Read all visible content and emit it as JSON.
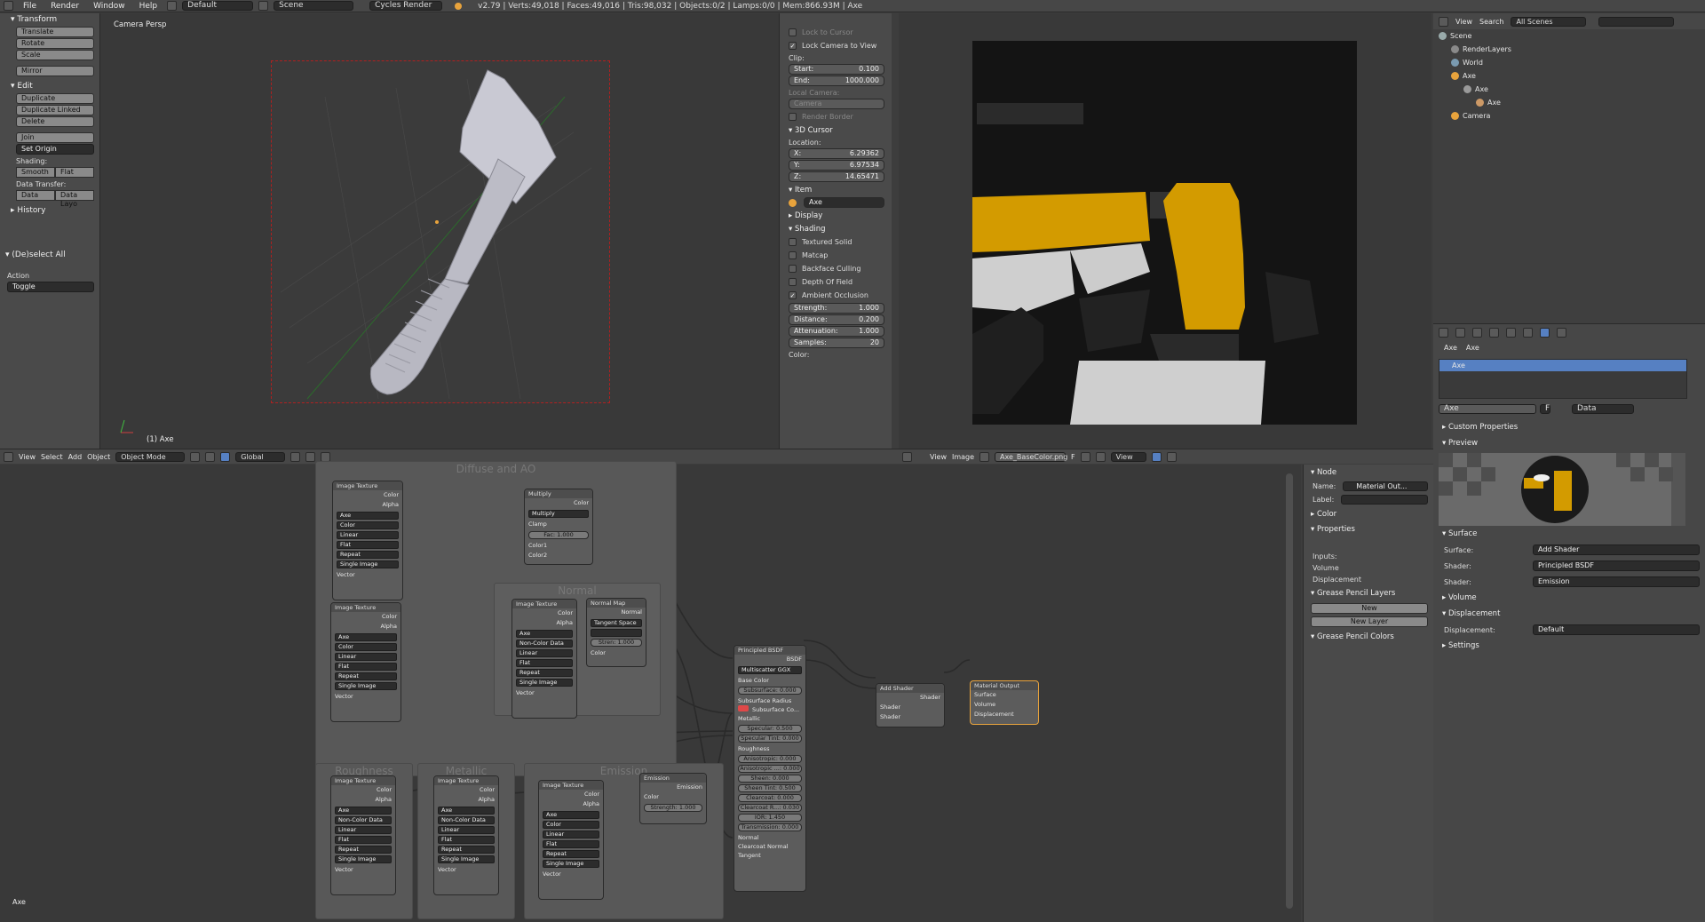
{
  "topbar": {
    "menus": [
      "File",
      "Render",
      "Window",
      "Help"
    ],
    "layout": "Default",
    "scene": "Scene",
    "engine": "Cycles Render",
    "stats": "v2.79 | Verts:49,018 | Faces:49,016 | Tris:98,032 | Objects:0/2 | Lamps:0/0 | Mem:866.93M | Axe"
  },
  "toolshelf": {
    "transform_title": "Transform",
    "translate": "Translate",
    "rotate": "Rotate",
    "scale": "Scale",
    "mirror": "Mirror",
    "edit_title": "Edit",
    "duplicate": "Duplicate",
    "duplicate_linked": "Duplicate Linked",
    "delete": "Delete",
    "join": "Join",
    "set_origin": "Set Origin",
    "shading_label": "Shading:",
    "smooth": "Smooth",
    "flat": "Flat",
    "data_transfer_label": "Data Transfer:",
    "data": "Data",
    "data_layo": "Data Layo",
    "history": "History",
    "deselect_all": "(De)select All",
    "action_label": "Action",
    "action_value": "Toggle"
  },
  "viewport": {
    "label": "Camera Persp",
    "object_label": "(1) Axe"
  },
  "npanel": {
    "lock_to_cursor": "Lock to Cursor",
    "lock_camera": "Lock Camera to View",
    "clip_label": "Clip:",
    "start_label": "Start:",
    "start_value": "0.100",
    "end_label": "End:",
    "end_value": "1000.000",
    "local_camera": "Local Camera:",
    "camera": "Camera",
    "render_border": "Render Border",
    "cursor_title": "3D Cursor",
    "location": "Location:",
    "x_label": "X:",
    "x_value": "6.29362",
    "y_label": "Y:",
    "y_value": "6.97534",
    "z_label": "Z:",
    "z_value": "14.65471",
    "item_title": "Item",
    "item_name": "Axe",
    "display_title": "Display",
    "shading_title": "Shading",
    "textured_solid": "Textured Solid",
    "matcap": "Matcap",
    "backface": "Backface Culling",
    "dof": "Depth Of Field",
    "ao": "Ambient Occlusion",
    "strength_label": "Strength:",
    "strength_value": "1.000",
    "distance_label": "Distance:",
    "distance_value": "0.200",
    "attenuation_label": "Attenuation:",
    "attenuation_value": "1.000",
    "samples_label": "Samples:",
    "samples_value": "20",
    "color_label": "Color:"
  },
  "viewport_header": {
    "view": "View",
    "select": "Select",
    "add": "Add",
    "object": "Object",
    "mode": "Object Mode",
    "orientation": "Global"
  },
  "image_header": {
    "view": "View",
    "image": "Image",
    "image_name": "Axe_BaseColor.png",
    "f": "F",
    "view2": "View"
  },
  "outliner": {
    "view": "View",
    "search": "Search",
    "all_scenes": "All Scenes",
    "rows": [
      "Scene",
      "RenderLayers",
      "World",
      "Axe",
      "Axe",
      "Axe",
      "Camera"
    ]
  },
  "properties": {
    "breadcrumb_a": "Axe",
    "breadcrumb_b": "Axe",
    "slot": "Axe",
    "material": "Axe",
    "f": "F",
    "data": "Data",
    "custom_props": "Custom Properties",
    "preview": "Preview",
    "surface_title": "Surface",
    "surface_label": "Surface:",
    "surface_value": "Add Shader",
    "shader_label": "Shader:",
    "shader1": "Principled BSDF",
    "shader2": "Emission",
    "volume": "Volume",
    "displacement_title": "Displacement",
    "displacement_label": "Displacement:",
    "displacement_value": "Default",
    "settings": "Settings"
  },
  "node_sidebar": {
    "node_title": "Node",
    "name_label": "Name:",
    "name_value": "Material Out...",
    "label_label": "Label:",
    "color_title": "Color",
    "properties_title": "Properties",
    "inputs": "Inputs:",
    "volume": "Volume",
    "displacement": "Displacement",
    "gp_layers": "Grease Pencil Layers",
    "new": "New",
    "new_layer": "New Layer",
    "gp_colors": "Grease Pencil Colors"
  },
  "node_editor": {
    "footer_label": "Axe",
    "frames": {
      "diffuse": "Diffuse and AO",
      "normal": "Normal",
      "roughness": "Roughness",
      "metallic": "Metallic",
      "emission": "Emission"
    },
    "image_texture": {
      "title": "Image Texture",
      "color": "Color",
      "alpha": "Alpha",
      "img": "Axe",
      "color_space": "Color",
      "non_color": "Non-Color Data",
      "interp": "Linear",
      "proj": "Flat",
      "ext": "Repeat",
      "source": "Single Image",
      "vector": "Vector"
    },
    "multiply": {
      "title": "Multiply",
      "color": "Color",
      "mode": "Multiply",
      "clamp": "Clamp",
      "fac": "Fac:",
      "fac_value": "1.000",
      "color1": "Color1",
      "color2": "Color2"
    },
    "normal_map": {
      "title": "Normal Map",
      "normal": "Normal",
      "space": "Tangent Space",
      "strength": "Stren:",
      "strength_value": "1.000",
      "color": "Color"
    },
    "emission": {
      "title": "Emission",
      "emission": "Emission",
      "color": "Color",
      "strength": "Strength:",
      "strength_value": "1.000"
    },
    "bsdf": {
      "title": "Principled BSDF",
      "out": "BSDF",
      "dist": "Multiscatter GGX",
      "sss": "Subsurface Radius",
      "rows": [
        [
          "Base Color",
          ""
        ],
        [
          "Subsurface:",
          "0.000"
        ],
        [
          "Subsurface Radius",
          ""
        ],
        [
          "Subsurface Co...",
          ""
        ],
        [
          "Metallic",
          ""
        ],
        [
          "Specular:",
          "0.500"
        ],
        [
          "Specular Tint:",
          "0.000"
        ],
        [
          "Roughness",
          ""
        ],
        [
          "Anisotropic:",
          "0.000"
        ],
        [
          "Anisotropic ...:",
          "0.000"
        ],
        [
          "Sheen:",
          "0.000"
        ],
        [
          "Sheen Tint:",
          "0.500"
        ],
        [
          "Clearcoat:",
          "0.000"
        ],
        [
          "Clearcoat R...:",
          "0.030"
        ],
        [
          "IOR:",
          "1.450"
        ],
        [
          "Transmission:",
          "0.000"
        ],
        [
          "Normal",
          ""
        ],
        [
          "Clearcoat Normal",
          ""
        ],
        [
          "Tangent",
          ""
        ]
      ]
    },
    "add_shader": {
      "title": "Add Shader",
      "shader": "Shader",
      "in1": "Shader",
      "in2": "Shader"
    },
    "output": {
      "title": "Material Output",
      "surface": "Surface",
      "volume": "Volume",
      "displacement": "Displacement"
    }
  },
  "colors": {
    "accent_blue": "#5680c2",
    "selected_orange": "#e8a33c",
    "texture_yellow": "#d39b00"
  }
}
